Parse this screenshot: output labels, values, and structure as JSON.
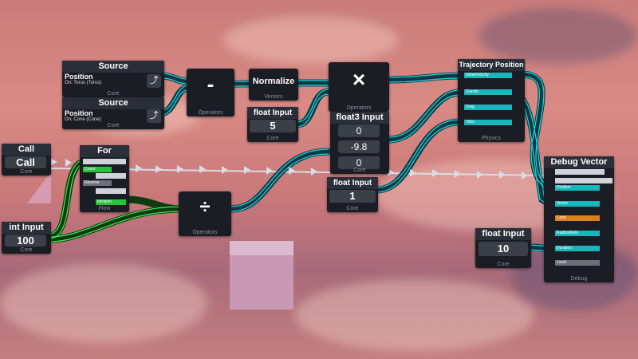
{
  "nodes": {
    "source1": {
      "title": "Source",
      "label": "Position",
      "sub": "On: Torus (Torus)",
      "footer": "Core",
      "icon": "corner-up-right-icon"
    },
    "source2": {
      "title": "Source",
      "label": "Position",
      "sub": "On: Cone (Cone)",
      "footer": "Core",
      "icon": "corner-up-right-icon"
    },
    "subtract": {
      "symbol": "-",
      "footer": "Operators"
    },
    "normalize": {
      "title": "Normalize",
      "footer": "Vectors"
    },
    "multiply": {
      "symbol": "×",
      "footer": "Operators"
    },
    "float_input_5": {
      "title": "float Input",
      "value": "5",
      "footer": "Core"
    },
    "float3_input": {
      "title": "float3 Input",
      "values": [
        "0",
        "-9.8",
        "0"
      ],
      "footer": "Core"
    },
    "float_input_1": {
      "title": "float Input",
      "value": "1",
      "footer": "Core"
    },
    "trajectory": {
      "title": "Trajectory Position",
      "pins": [
        "InitialVelocity",
        "Gravity",
        "Drag",
        "Time"
      ],
      "footer": "Physics"
    },
    "call": {
      "title": "Call",
      "value": "Call",
      "footer": "Core"
    },
    "for_loop": {
      "title": "For",
      "pins": [
        "Count",
        "Reverse",
        "Iteration"
      ],
      "footer": "Flow"
    },
    "int_input": {
      "title": "int Input",
      "value": "100",
      "footer": "Core"
    },
    "divide": {
      "symbol": "÷",
      "footer": "Operators"
    },
    "debug_vector": {
      "title": "Debug Vector",
      "pins": [
        "Position",
        "Vector",
        "Color",
        "RadiusRatio",
        "Duration",
        "Local"
      ],
      "footer": "Debug"
    },
    "float_input_10": {
      "title": "float Input",
      "value": "10",
      "footer": "Core"
    }
  },
  "colors": {
    "cyan": "#19b6bb",
    "green": "#25c43a",
    "orange": "#d9821b",
    "node_bg": "#1b1d24"
  }
}
